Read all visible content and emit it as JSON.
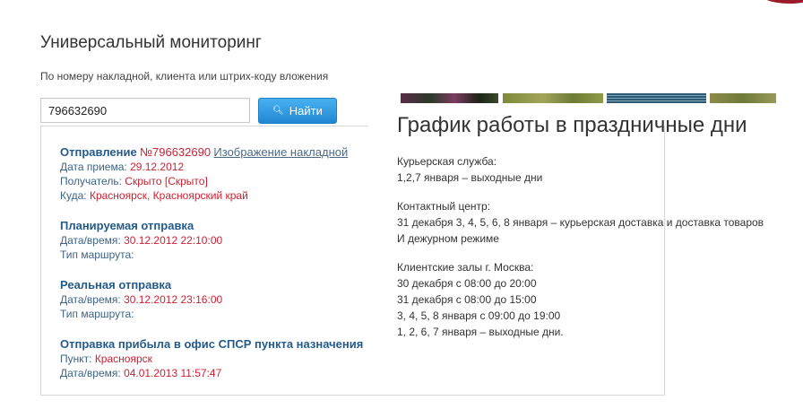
{
  "header": {
    "title": "Универсальный мониторинг",
    "subtitle": "По номеру накладной, клиента или штрих-коду вложения"
  },
  "search": {
    "value": "796632690",
    "button_label": "Найти"
  },
  "shipment": {
    "head_label": "Отправление",
    "number": "№796632690",
    "invoice_link": "Изображение накладной",
    "date_label": "Дата приема:",
    "date_value": "29.12.2012",
    "recipient_label": "Получатель:",
    "recipient_value": "Скрыто [Скрыто]",
    "dest_label": "Куда:",
    "dest_value": "Красноярск, Красноярский край"
  },
  "events": [
    {
      "title": "Планируемая отправка",
      "line1_label": "Дата/время:",
      "line1_value": "30.12.2012 22:10:00",
      "line2_label": "Тип маршрута:",
      "line2_value": ""
    },
    {
      "title": "Реальная отправка",
      "line1_label": "Дата/время:",
      "line1_value": "30.12.2012 23:16:00",
      "line2_label": "Тип маршрута:",
      "line2_value": ""
    },
    {
      "title": "Отправка прибыла в офис СПСР пункта назначения",
      "line1_label": "Пункт:",
      "line1_value": "Красноярск",
      "line2_label": "Дата/время:",
      "line2_value": "04.01.2013 11:57:47"
    }
  ],
  "holiday": {
    "title": "График работы в праздничные дни",
    "courier_heading": "Курьерская служба:",
    "courier_line": "1,2,7 января – выходные дни",
    "contact_heading": "Контактный центр:",
    "contact_line": "31 декабря 3, 4, 5, 6, 8 января – курьерская доставка и доставка товаров И дежурном режиме",
    "halls_heading": "Клиентские залы г. Москва:",
    "halls_lines": [
      "30 декабря с 08:00 до 20:00",
      "31 декабря с 08:00 до 15:00",
      "3, 4, 5, 8 января с 09:00 до 19:00",
      "1, 2, 6, 7 января – выходные дни."
    ]
  },
  "colors": {
    "accent_red": "#cc2233",
    "heading_blue": "#245b8b",
    "button_blue": "#2287d3"
  }
}
